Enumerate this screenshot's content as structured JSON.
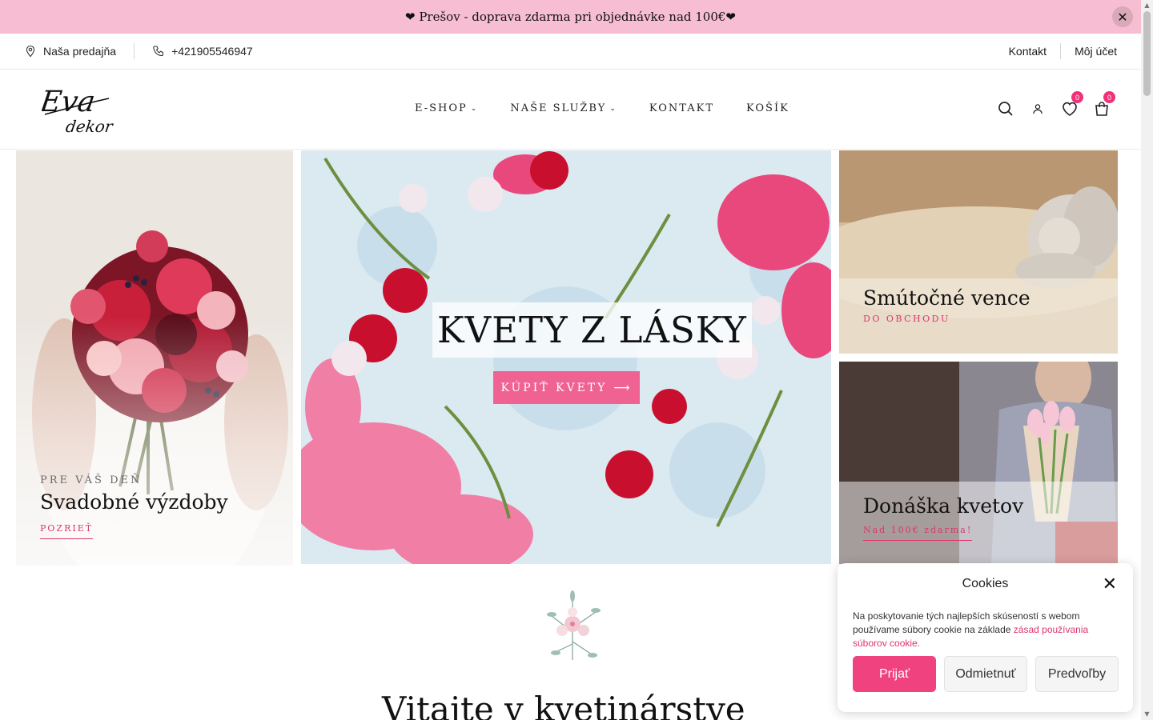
{
  "promo": {
    "text": "❤ Prešov - doprava zdarma pri objednávke nad 100€❤",
    "close_icon": "close-icon"
  },
  "utility": {
    "store_label": "Naša predajňa",
    "phone": "+421905546947",
    "contact_label": "Kontakt",
    "account_label": "Môj účet"
  },
  "header": {
    "logo_text_1": "Eva",
    "logo_text_2": "dekor",
    "nav": [
      {
        "label": "E-SHOP"
      },
      {
        "label": "NAŠE SLUŽBY"
      },
      {
        "label": "KONTAKT"
      },
      {
        "label": "KOŠÍK"
      }
    ],
    "wishlist_count": "0",
    "cart_count": "0"
  },
  "hero": {
    "left": {
      "eyebrow": "PRE VÁŠ DEŇ",
      "title": "Svadobné výzdoby",
      "link": "POZRIEŤ"
    },
    "center": {
      "title": "KVETY Z LÁSKY",
      "button": "KÚPIŤ KVETY"
    },
    "right_top": {
      "title": "Smútočné vence",
      "link": "DO OBCHODU"
    },
    "right_bottom": {
      "title": "Donáška kvetov",
      "link": "Nad 100€ zdarma!"
    }
  },
  "welcome": {
    "title": "Vitajte v kvetinárstve"
  },
  "cookies": {
    "title": "Cookies",
    "text": "Na poskytovanie tých najlepších skúseností s webom používame súbory cookie na základe ",
    "link": "zásad používania súborov cookie.",
    "accept": "Prijať",
    "decline": "Odmietnuť",
    "preferences": "Predvoľby"
  },
  "colors": {
    "promo_bg": "#f7bdd3",
    "accent": "#f06292",
    "link": "#e0336f"
  }
}
